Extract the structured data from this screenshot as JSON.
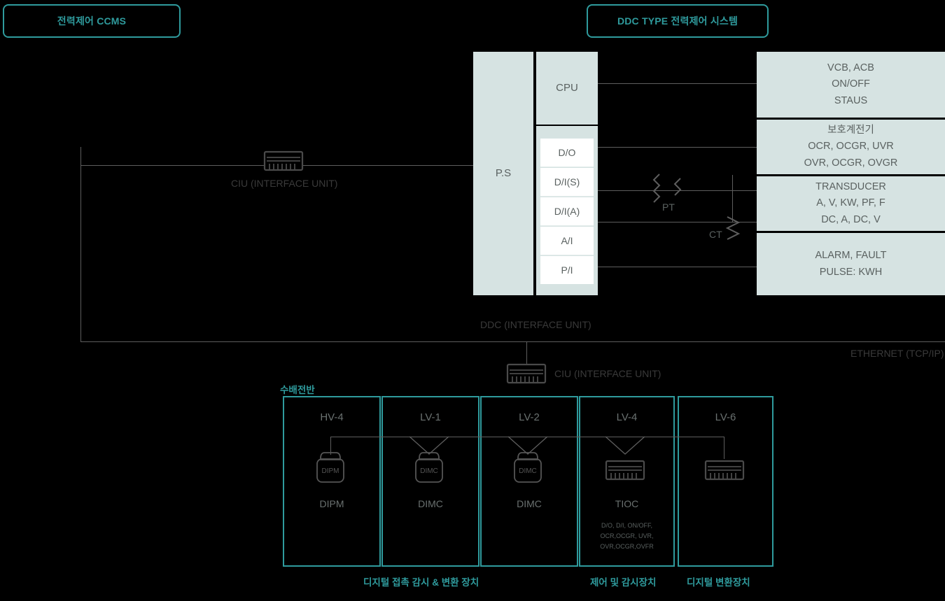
{
  "headers": {
    "left_pill": "전력제어 CCMS",
    "right_pill": "DDC TYPE 전력제어 시스템"
  },
  "controller": {
    "power_supply": "P.S",
    "cpu": "CPU",
    "io_modules": [
      {
        "label": "D/O"
      },
      {
        "label": "D/I(S)"
      },
      {
        "label": "D/I(A)"
      },
      {
        "label": "A/I"
      },
      {
        "label": "P/I"
      }
    ]
  },
  "right_blocks": [
    {
      "lines": [
        "VCB, ACB",
        "ON/OFF",
        "STAUS"
      ]
    },
    {
      "lines": [
        "보호계전기",
        "OCR, OCGR, UVR",
        "OVR, OCGR, OVGR"
      ]
    },
    {
      "lines": [
        "TRANSDUCER",
        "A, V, KW, PF, F",
        "DC, A, DC, V"
      ]
    },
    {
      "lines": [
        "ALARM, FAULT",
        "PULSE: KWH"
      ]
    }
  ],
  "transformers": {
    "pt": "PT",
    "ct": "CT"
  },
  "labels": {
    "ciu_top": "CIU (INTERFACE UNIT)",
    "ddc_bus": "DDC (INTERFACE UNIT)",
    "ethernet": "ETHERNET (TCP/IP)",
    "ciu_bottom": "CIU (INTERFACE UNIT)",
    "switchgear": "수배전반"
  },
  "panels": [
    {
      "title": "HV-4",
      "device": "DIPM",
      "icon": "dipm-device-icon",
      "connector": "straight",
      "detail": ""
    },
    {
      "title": "LV-1",
      "device": "DIMC",
      "icon": "dimc-device-icon",
      "connector": "vee",
      "detail": ""
    },
    {
      "title": "LV-2",
      "device": "DIMC",
      "icon": "dimc-device-icon",
      "connector": "vee",
      "detail": ""
    },
    {
      "title": "LV-4",
      "device": "TIOC",
      "icon": "terminal-block-icon",
      "connector": "vee",
      "detail": "D/O, D/I, ON/OFF,\nOCR,OCGR, UVR,\nOVR,OCGR,OVFR"
    },
    {
      "title": "LV-6",
      "device": "",
      "icon": "terminal-block-icon",
      "connector": "straight",
      "detail": ""
    }
  ],
  "captions": [
    {
      "text": "디지털 접촉 감시 & 변환 장치"
    },
    {
      "text": "제어 및 감시장치"
    },
    {
      "text": "디지털 변환장치"
    }
  ],
  "colors": {
    "teal": "#2f9b9d",
    "panel_fill": "#d6e3e2",
    "line": "#5e5e5e",
    "background": "#000000"
  }
}
